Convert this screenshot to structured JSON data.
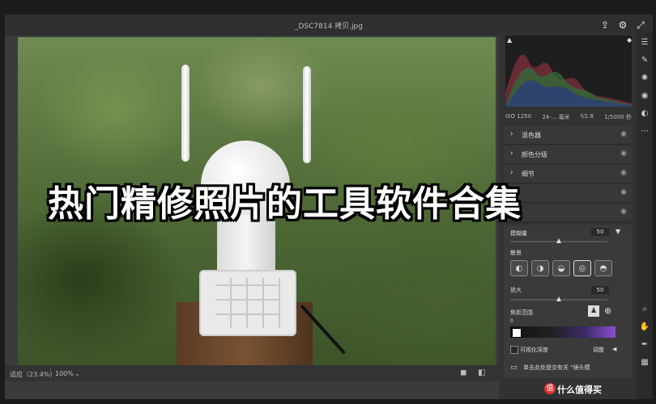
{
  "window": {
    "title": "_DSC7814 拷贝.jpg"
  },
  "overlay_text": "热门精修照片的工具软件合集",
  "status": {
    "fit_label": "适应（23.4%）",
    "zoom_label": "100%"
  },
  "exif": {
    "iso": "ISO 1250",
    "focal": "24-... 毫米",
    "aperture": "f/2.8",
    "shutter": "1/5000 秒"
  },
  "sections": [
    {
      "label": "混色器"
    },
    {
      "label": "颜色分级"
    },
    {
      "label": "细节"
    }
  ],
  "lens_blur": {
    "amount_label": "模糊量",
    "amount_value": "50",
    "bokeh_label": "散景",
    "boost_label": "放大",
    "boost_value": "50",
    "focus_range_label": "焦距范围",
    "focus_range_start": "0",
    "visualize_depth_label": "可视化深度",
    "adjust_label": "调整",
    "feedback_text": "单击此处提交有关 \"镜头模"
  },
  "watermark": {
    "badge": "值",
    "text": "什么值得买"
  },
  "colors": {
    "accent": "#1473e6",
    "panel": "#323232",
    "frame": "#3b3b3b"
  },
  "icons": [
    "export-icon",
    "gear-icon",
    "expand-icon",
    "eye-icon",
    "search-icon",
    "hand-icon",
    "grid-icon"
  ]
}
